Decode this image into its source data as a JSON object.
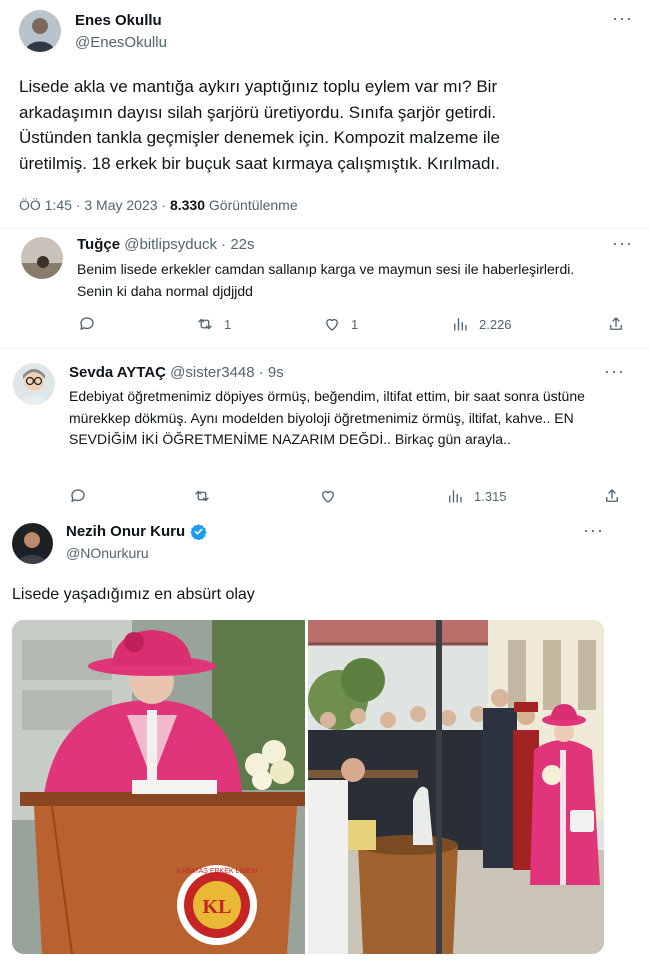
{
  "tweet1": {
    "display_name": "Enes Okullu",
    "handle": "@EnesOkullu",
    "text": "Lisede akla ve mantığa aykırı yaptığınız toplu eylem var mı? Bir arkadaşımın dayısı silah şarjörü üretiyordu. Sınıfa şarjör getirdi. Üstünden tankla geçmişler denemek için. Kompozit malzeme ile üretilmiş. 18 erkek bir buçuk saat kırmaya çalışmıştık. Kırılmadı.",
    "time": "ÖÖ 1:45 · 3 May 2023 · ",
    "views_count": "8.330",
    "views_label": " Görüntülenme",
    "more": "···"
  },
  "tweet2": {
    "display_name": "Tuğçe",
    "handle": "@bitlipsyduck",
    "time": "· 22s",
    "text": "Benim lisede erkekler camdan sallanıp karga ve maymun sesi ile haberleşirlerdi. Senin ki daha normal djdjjdd",
    "replies": "",
    "retweets": "1",
    "likes": "1",
    "views": "2.226",
    "more": "···"
  },
  "tweet3": {
    "display_name": "Sevda AYTAÇ",
    "handle": "@sister3448",
    "time": "· 9s",
    "text": "Edebiyat öğretmenimiz döpiyes örmüş, beğendim, iltifat ettim, bir saat sonra üstüne mürekkep dökmüş. Aynı modelden biyoloji öğretmenimiz örmüş, iltifat, kahve.. EN SEVDİĞİM İKİ ÖĞRETMENİME NAZARIM DEĞDİ.. Birkaç gün arayla..",
    "replies": "",
    "retweets": "",
    "likes": "",
    "views": "1.315",
    "more": "···"
  },
  "tweet4": {
    "display_name": "Nezih Onur Kuru",
    "handle": "@NOnurkuru",
    "text": "Lisede yaşadığımız en absürt olay",
    "more": "···",
    "verified_icon": "verified-badge-icon",
    "lectern_logo_text": "KABATAŞ ERKEK LİSESİ",
    "lectern_logo_initials": "KL"
  },
  "colors": {
    "text": "#0f1419",
    "muted": "#536471",
    "verified": "#1d9bf0",
    "pink": "#e0357a"
  }
}
